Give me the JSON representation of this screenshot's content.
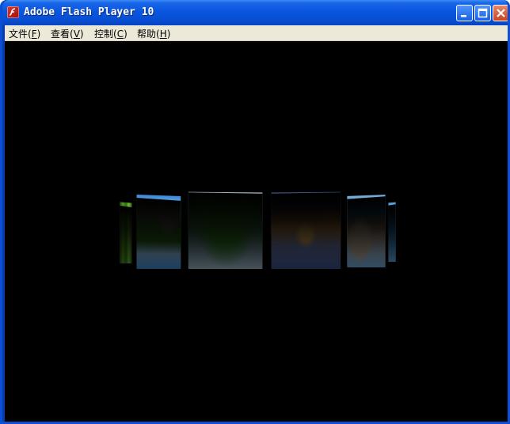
{
  "window": {
    "title": "Adobe Flash Player 10",
    "controls": {
      "minimize": "minimize",
      "maximize": "maximize",
      "close": "close"
    }
  },
  "menubar": {
    "items": [
      {
        "label": "文件",
        "accel": "F"
      },
      {
        "label": "查看",
        "accel": "V"
      },
      {
        "label": "控制",
        "accel": "C"
      },
      {
        "label": "帮助",
        "accel": "H"
      }
    ]
  },
  "gallery": {
    "cards": [
      {
        "id": "bamboo-forest",
        "icon": "green-foliage-photo"
      },
      {
        "id": "river-rocks",
        "icon": "river-landscape-photo"
      },
      {
        "id": "misty-mountains",
        "icon": "mountain-valley-photo"
      },
      {
        "id": "vatican-bridge-night",
        "icon": "city-bridge-photo"
      },
      {
        "id": "sea-arch",
        "icon": "coastal-arch-photo"
      },
      {
        "id": "ocean-edge",
        "icon": "ocean-photo"
      }
    ]
  },
  "colors": {
    "titlebar": "#0a56e0",
    "menubar": "#ece9d8",
    "stage": "#000000",
    "close_button": "#c9431f"
  }
}
